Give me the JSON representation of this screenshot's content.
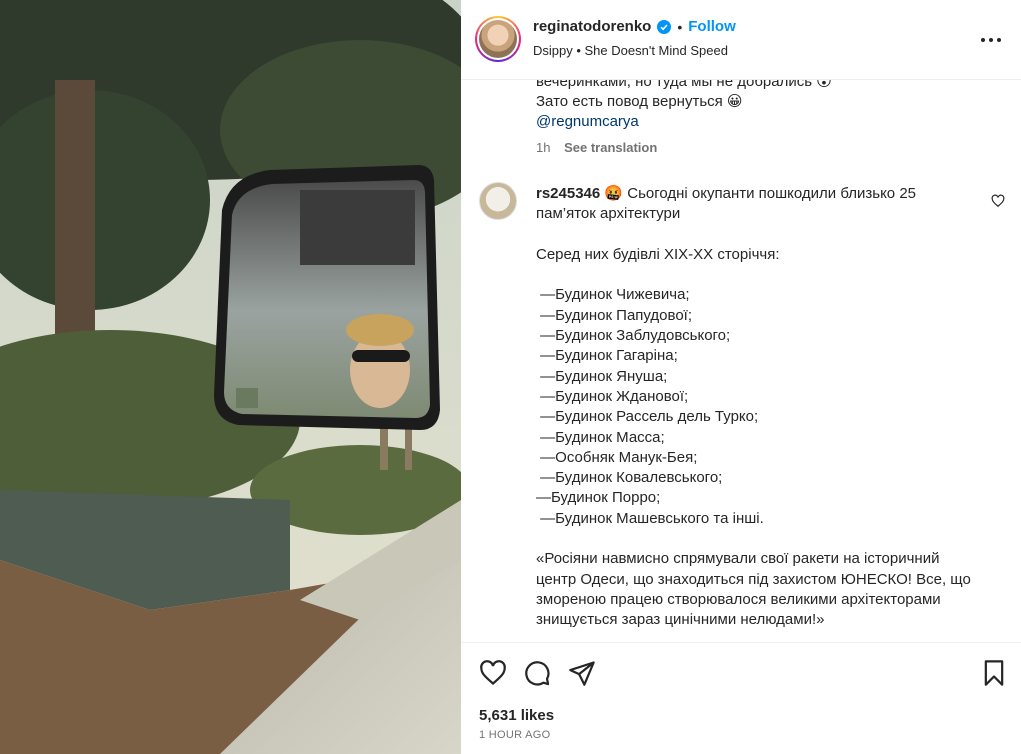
{
  "header": {
    "username": "reginatodorenko",
    "separator": "•",
    "follow_label": "Follow",
    "audio": "Dsippy • She Doesn't Mind Speed",
    "verified_icon": "verified-badge-icon",
    "more_icon": "more-options-icon"
  },
  "caption": {
    "line1": "вечеринками, но туда мы не добрались 😮",
    "line2": "Зато есть повод вернуться 😀",
    "mention": "@regnumcarya",
    "time": "1h",
    "see_translation": "See translation"
  },
  "comment": {
    "username": "rs245346",
    "text": " 🤬 Сьогодні окупанти пошкодили близько 25 пам’яток архітектури\n\nСеред них будівлі XIX-XX сторіччя:\n\n —Будинок Чижевича;\n —Будинок Папудової;\n —Будинок Заблудовського;\n —Будинок Гагаріна;\n —Будинок Януша;\n —Будинок Жданової;\n —Будинок Рассель дель Турко;\n —Будинок Масса;\n —Особняк Манук-Бея;\n —Будинок Ковалевського;\n—Будинок Порро;\n —Будинок Машевського та інші.\n\n«Росіяни навмисно спрямували свої ракети на історичний центр Одеси, що знаходиться під захистом ЮНЕСКО! Все, що змореною працею створювалося великими архітекторами знищується зараз цинічними нелюдами!»"
  },
  "actions": {
    "likes": "5,631 likes",
    "time": "1 HOUR AGO"
  },
  "colors": {
    "accent": "#0095f6",
    "text": "#262626",
    "secondary": "#737373",
    "mention": "#00376b"
  }
}
